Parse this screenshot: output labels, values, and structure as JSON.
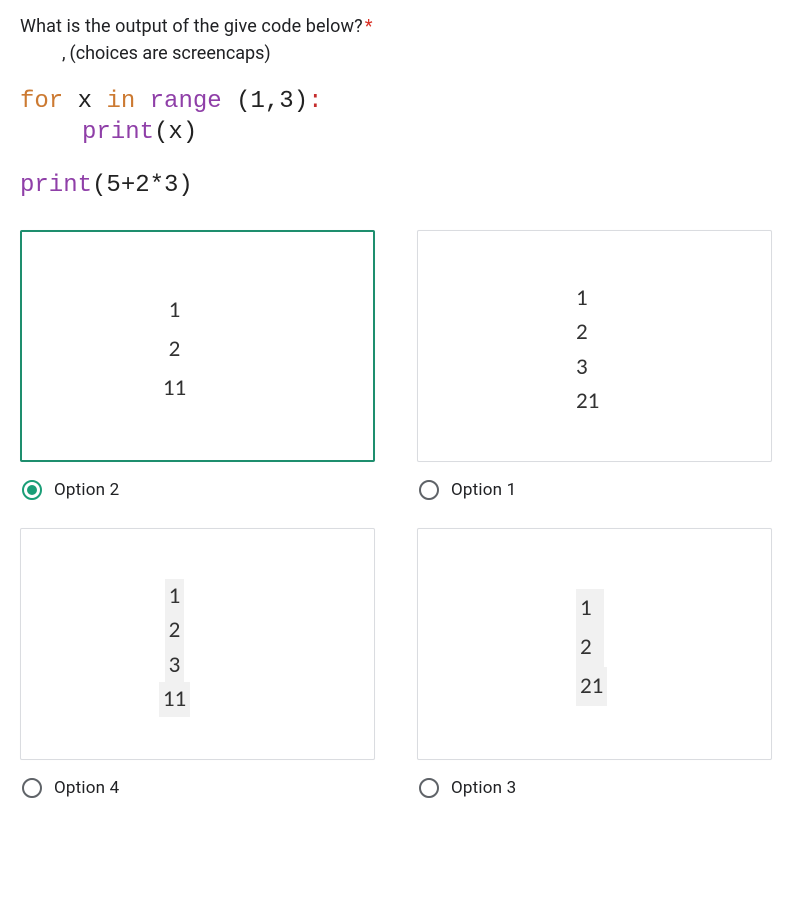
{
  "question": {
    "text": "What is the output of the give code below?",
    "required_marker": "*",
    "subnote": "(choices are screencaps)"
  },
  "code": {
    "line1_for": "for",
    "line1_var": "x",
    "line1_in": "in",
    "line1_range": "range",
    "line1_args": "(1,3)",
    "line1_colon": ":",
    "line2_print": "print",
    "line2_args": "(x)",
    "line3_print": "print",
    "line3_args": "(5+2*3)"
  },
  "options": {
    "a": {
      "lines": [
        "1",
        "2",
        "11"
      ],
      "label": "Option 2",
      "selected": true
    },
    "b": {
      "lines": [
        "1",
        "2",
        "3",
        "21"
      ],
      "label": "Option 1",
      "selected": false
    },
    "c": {
      "lines": [
        "1",
        "2",
        "3",
        "11"
      ],
      "label": "Option 4",
      "selected": false
    },
    "d": {
      "lines": [
        "1",
        "2",
        "21"
      ],
      "label": "Option 3",
      "selected": false
    }
  }
}
